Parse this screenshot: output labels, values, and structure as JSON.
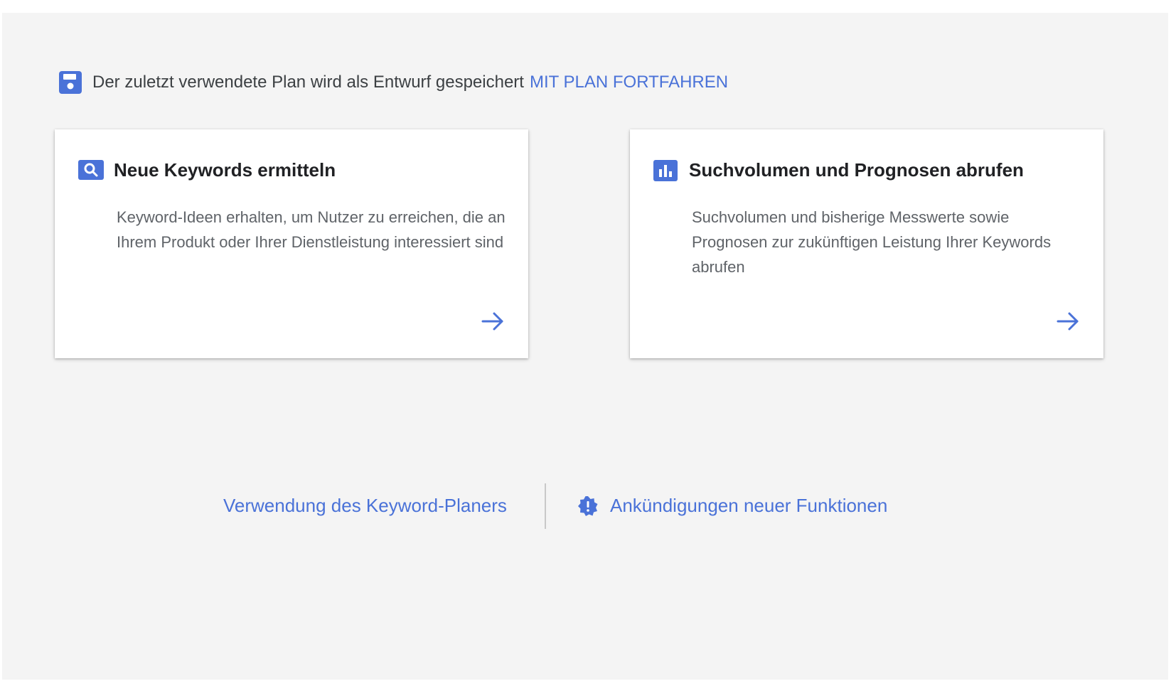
{
  "draft_notice": {
    "icon": "save-icon",
    "message": "Der zuletzt verwendete Plan wird als Entwurf gespeichert",
    "action_label": "MIT PLAN FORTFAHREN"
  },
  "cards": [
    {
      "icon": "search-icon",
      "title": "Neue Keywords ermitteln",
      "description": "Keyword-Ideen erhalten, um Nutzer zu erreichen, die an Ihrem Produkt oder Ihrer Dienstleistung interessiert sind",
      "arrow_icon": "arrow-right-icon"
    },
    {
      "icon": "bar-chart-icon",
      "title": "Suchvolumen und Prognosen abrufen",
      "description": "Suchvolumen und bisherige Messwerte sowie Prognosen zur zukünftigen Leistung Ihrer Keywords abrufen",
      "arrow_icon": "arrow-right-icon"
    }
  ],
  "footer": {
    "help_link": "Verwendung des Keyword-Planers",
    "announcements_icon": "new-badge-icon",
    "announcements_link": "Ankündigungen neuer Funktionen"
  },
  "colors": {
    "accent": "#4a72d8",
    "background": "#f4f4f4",
    "card": "#ffffff",
    "title_text": "#202124",
    "body_text": "#5f6368"
  }
}
